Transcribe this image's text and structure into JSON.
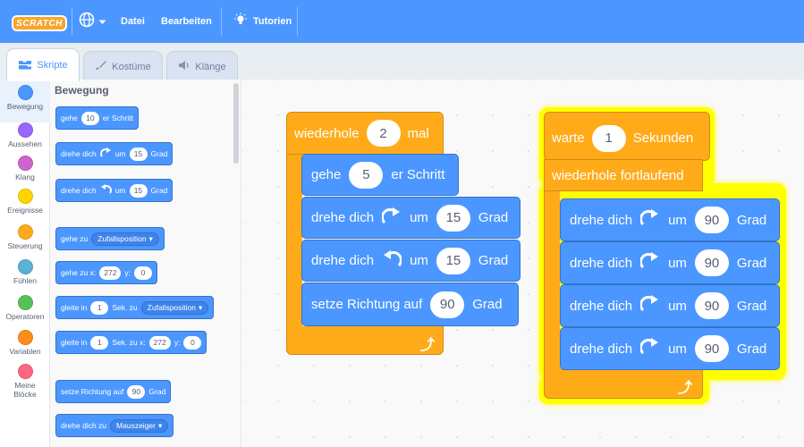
{
  "menubar": {
    "logo": "SCRATCH",
    "file_label": "Datei",
    "edit_label": "Bearbeiten",
    "tutorials_label": "Tutorien",
    "colors": {
      "bar": "#4c97ff",
      "logo": "#f7a62c"
    }
  },
  "tabs": {
    "code": "Skripte",
    "costumes": "Kostüme",
    "sounds": "Klänge"
  },
  "categories": [
    {
      "label": "Bewegung",
      "color": "#4c97ff"
    },
    {
      "label": "Aussehen",
      "color": "#9966ff"
    },
    {
      "label": "Klang",
      "color": "#cf63cf"
    },
    {
      "label": "Ereignisse",
      "color": "#ffd500"
    },
    {
      "label": "Steuerung",
      "color": "#ffab19"
    },
    {
      "label": "Fühlen",
      "color": "#5cb1d6"
    },
    {
      "label": "Operatoren",
      "color": "#59c059"
    },
    {
      "label": "Variablen",
      "color": "#ff8c1a"
    },
    {
      "label": "Meine Blöcke",
      "color": "#ff6680"
    }
  ],
  "palette": {
    "title": "Bewegung",
    "move": {
      "pre": "gehe",
      "value": "10",
      "post": "er Schritt"
    },
    "turn_right": {
      "pre": "drehe dich",
      "mid": "um",
      "value": "15",
      "post": "Grad"
    },
    "turn_left": {
      "pre": "drehe dich",
      "mid": "um",
      "value": "15",
      "post": "Grad"
    },
    "goto": {
      "pre": "gehe zu",
      "dropdown": "Zufallsposition"
    },
    "goto_xy": {
      "pre": "gehe zu x:",
      "x": "272",
      "ylabel": "y:",
      "y": "0"
    },
    "glide": {
      "pre": "gleite in",
      "value": "1",
      "mid": "Sek. zu",
      "dropdown": "Zufallsposition"
    },
    "glide_xy": {
      "pre": "gleite in",
      "value": "1",
      "mid": "Sek. zu x:",
      "x": "272",
      "ylabel": "y:",
      "y": "0"
    },
    "point_dir": {
      "pre": "setze Richtung auf",
      "value": "90",
      "post": "Grad"
    },
    "point_towards": {
      "pre": "drehe dich zu",
      "dropdown": "Mauszeiger"
    }
  },
  "script1": {
    "repeat": {
      "pre": "wiederhole",
      "value": "2",
      "post": "mal"
    },
    "move": {
      "pre": "gehe",
      "value": "5",
      "post": "er Schritt"
    },
    "turn_right": {
      "pre": "drehe dich",
      "mid": "um",
      "value": "15",
      "post": "Grad"
    },
    "turn_left": {
      "pre": "drehe dich",
      "mid": "um",
      "value": "15",
      "post": "Grad"
    },
    "point_dir": {
      "pre": "setze Richtung auf",
      "value": "90",
      "post": "Grad"
    }
  },
  "script2": {
    "wait": {
      "pre": "warte",
      "value": "1",
      "post": "Sekunden"
    },
    "forever": {
      "label": "wiederhole fortlaufend"
    },
    "turns": [
      {
        "pre": "drehe dich",
        "mid": "um",
        "value": "90",
        "post": "Grad"
      },
      {
        "pre": "drehe dich",
        "mid": "um",
        "value": "90",
        "post": "Grad"
      },
      {
        "pre": "drehe dich",
        "mid": "um",
        "value": "90",
        "post": "Grad"
      },
      {
        "pre": "drehe dich",
        "mid": "um",
        "value": "90",
        "post": "Grad"
      }
    ],
    "glow_color": "#ffff00"
  }
}
